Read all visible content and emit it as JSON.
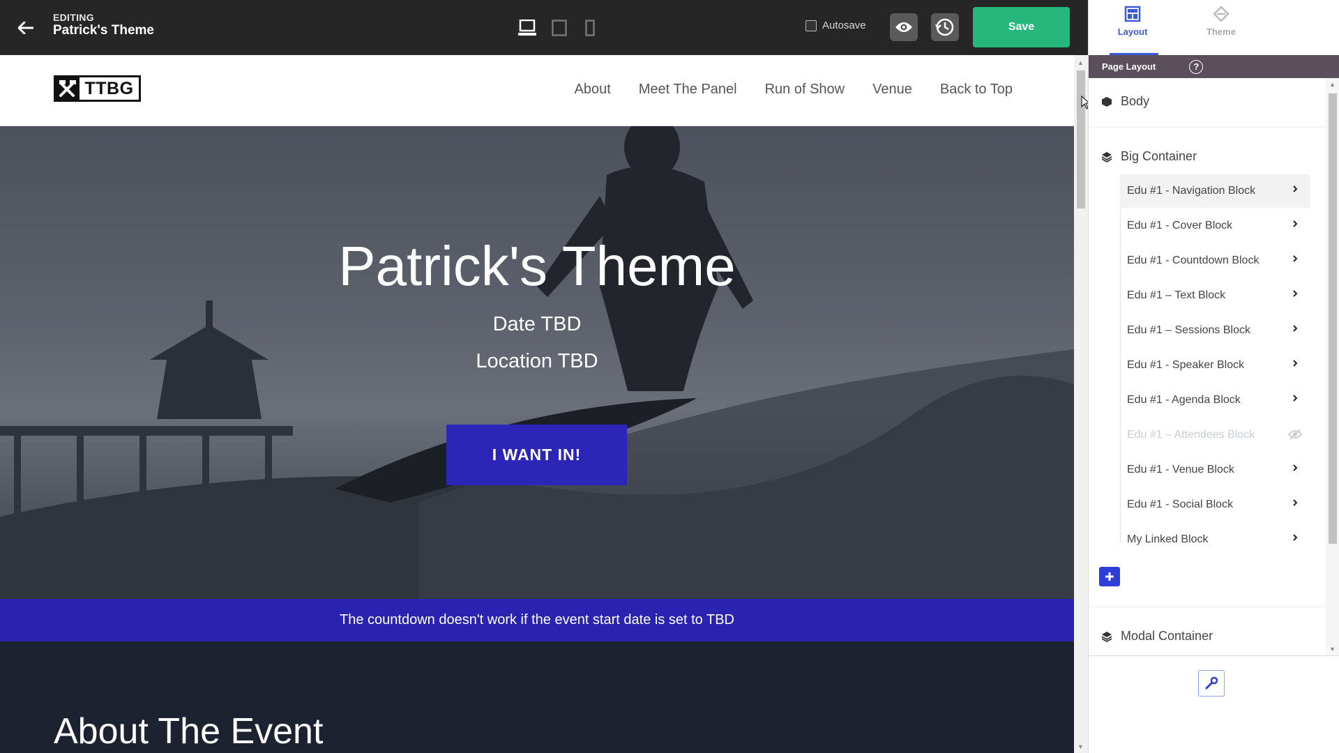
{
  "topbar": {
    "editing_label": "EDITING",
    "title": "Patrick's Theme",
    "autosave_label": "Autosave",
    "save_label": "Save"
  },
  "site": {
    "logo_text": "TTBG",
    "nav": [
      "About",
      "Meet The Panel",
      "Run of Show",
      "Venue",
      "Back to Top"
    ],
    "hero_title": "Patrick's Theme",
    "hero_date": "Date TBD",
    "hero_location": "Location TBD",
    "cta_label": "I WANT IN!",
    "countdown_notice": "The countdown doesn't work if the event start date is set to TBD",
    "about_title": "About The Event"
  },
  "panel": {
    "tabs": [
      "Layout",
      "Theme"
    ],
    "header": "Page Layout",
    "help_glyph": "?",
    "body_label": "Body",
    "big_container_label": "Big Container",
    "blocks": [
      "Edu #1 - Navigation Block",
      "Edu #1 - Cover Block",
      "Edu #1 - Countdown Block",
      "Edu #1 – Text Block",
      "Edu #1 – Sessions Block",
      "Edu #1 - Speaker Block",
      "Edu #1 - Agenda Block",
      "Edu #1 – Attendees Block",
      "Edu #1 - Venue Block",
      "Edu #1 - Social Block",
      "My Linked Block"
    ],
    "modal_container_label": "Modal Container"
  },
  "colors": {
    "save": "#25b77b",
    "accent_blue": "#2b26b8",
    "panel_header": "#5b4f5c",
    "tab_active": "#3b5bdb"
  }
}
